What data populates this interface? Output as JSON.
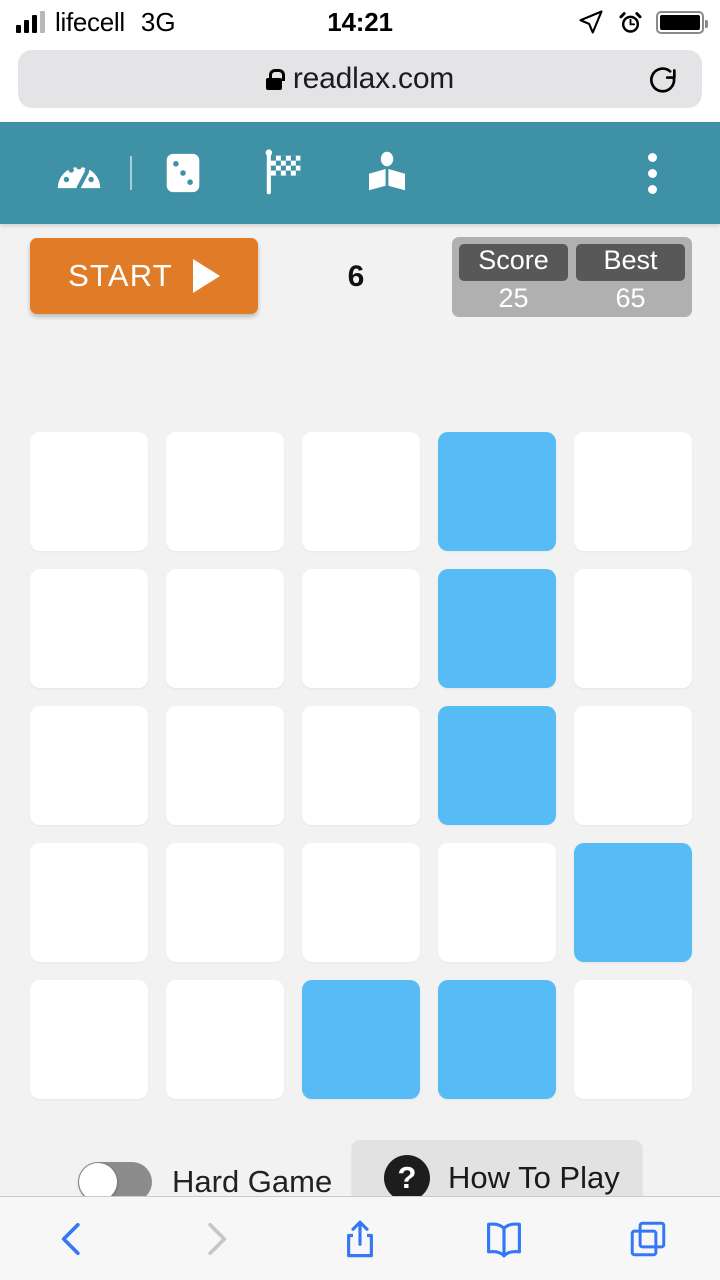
{
  "status_bar": {
    "carrier": "lifecell",
    "network": "3G",
    "time": "14:21",
    "icons": [
      "signal-bars-icon",
      "location-arrow-icon",
      "alarm-clock-icon",
      "battery-icon"
    ]
  },
  "browser": {
    "url": "readlax.com",
    "lock_icon": "lock-icon",
    "reload_icon": "reload-icon",
    "toolbar": {
      "back": "back-chevron-icon",
      "forward": "forward-chevron-icon",
      "share": "share-icon",
      "bookmarks": "book-icon",
      "tabs": "tabs-icon",
      "back_enabled_color": "#3478f6",
      "forward_disabled_color": "#c6c6c8"
    }
  },
  "app_nav": {
    "background": "#3f92a5",
    "items": [
      {
        "name": "speedometer-icon",
        "label": "Speed"
      },
      {
        "name": "divider",
        "label": ""
      },
      {
        "name": "dice-icon",
        "label": "Dice"
      },
      {
        "name": "checkered-flag-icon",
        "label": "Race"
      },
      {
        "name": "reader-book-icon",
        "label": "Reader"
      }
    ],
    "overflow_menu": "more-vertical-icon"
  },
  "game": {
    "start_label": "START",
    "start_color": "#e07b28",
    "play_icon": "play-triangle-icon",
    "counter": "6",
    "score": {
      "label": "Score",
      "value": "25"
    },
    "best": {
      "label": "Best",
      "value": "65"
    },
    "grid": {
      "rows": 5,
      "cols": 5,
      "cell_color": "#ffffff",
      "active_color": "#57bcf5",
      "cells": [
        [
          0,
          0,
          0,
          1,
          0
        ],
        [
          0,
          0,
          0,
          1,
          0
        ],
        [
          0,
          0,
          0,
          1,
          0
        ],
        [
          0,
          0,
          0,
          0,
          1
        ],
        [
          0,
          0,
          1,
          1,
          0
        ]
      ]
    },
    "hard_game": {
      "label": "Hard Game",
      "enabled": false
    },
    "how_to_play": {
      "label": "How To Play",
      "icon": "question-mark-icon"
    }
  }
}
